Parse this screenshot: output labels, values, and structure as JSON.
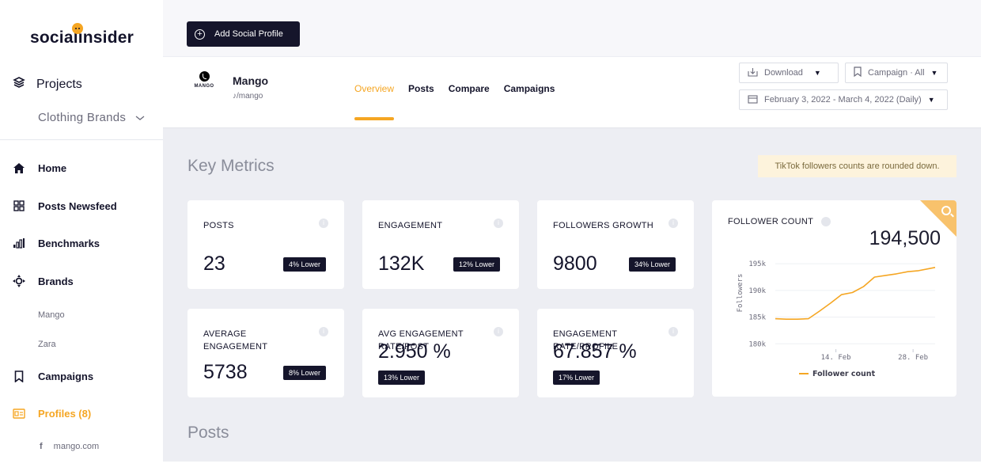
{
  "sidebar": {
    "logo": "socialinsider",
    "projects_label": "Projects",
    "project_selected": "Clothing Brands",
    "nav": {
      "home": "Home",
      "newsfeed": "Posts Newsfeed",
      "benchmarks": "Benchmarks",
      "brands": "Brands",
      "brand_mango": "Mango",
      "brand_zara": "Zara",
      "campaigns": "Campaigns",
      "profiles": "Profiles (8)",
      "profile_site": "mango.com"
    },
    "active_color": "#f5a623"
  },
  "topbar": {
    "add_profile_label": "Add Social Profile"
  },
  "profile": {
    "name": "Mango",
    "logo_text": "MANGO",
    "handle": "/mango",
    "tabs": [
      "Overview",
      "Posts",
      "Compare",
      "Campaigns"
    ],
    "active_tab": "Overview",
    "download_label": "Download",
    "campaign_label": "Campaign · All",
    "date_range": "February 3, 2022 - March 4, 2022 (Daily)"
  },
  "main": {
    "key_metrics_title": "Key Metrics",
    "note": "TikTok followers counts are rounded down.",
    "posts_title": "Posts",
    "metrics": {
      "posts": {
        "label": "POSTS",
        "value": "23",
        "badge": "4% Lower"
      },
      "engagement": {
        "label": "ENGAGEMENT",
        "value": "132K",
        "badge": "12% Lower"
      },
      "followers_growth": {
        "label": "FOLLOWERS GROWTH",
        "value": "9800",
        "badge": "34% Lower"
      },
      "avg_engagement": {
        "label": "AVERAGE ENGAGEMENT",
        "value": "5738",
        "badge": "8% Lower"
      },
      "avg_eng_rate_post": {
        "label": "AVG ENGAGEMENT RATE/POST",
        "value": "2.950 %",
        "badge": "13% Lower"
      },
      "eng_rate_profile": {
        "label": "ENGAGEMENT RATE/PROFILE",
        "value": "67.857 %",
        "badge": "17% Lower"
      }
    },
    "follower_count": {
      "label": "FOLLOWER COUNT",
      "value": "194,500"
    }
  },
  "chart_data": {
    "type": "line",
    "title": "FOLLOWER COUNT",
    "xlabel": "",
    "ylabel": "Followers",
    "ylim": [
      179000,
      196500
    ],
    "yticks": [
      180000,
      185000,
      190000,
      195000
    ],
    "ytick_labels": [
      "180k",
      "185k",
      "190k",
      "195k"
    ],
    "xticks": [
      "14. Feb",
      "28. Feb"
    ],
    "x": [
      "2022-02-03",
      "2022-02-05",
      "2022-02-07",
      "2022-02-09",
      "2022-02-11",
      "2022-02-13",
      "2022-02-15",
      "2022-02-17",
      "2022-02-19",
      "2022-02-21",
      "2022-02-23",
      "2022-02-25",
      "2022-02-27",
      "2022-03-01",
      "2022-03-03",
      "2022-03-04"
    ],
    "series": [
      {
        "name": "Follower count",
        "color": "#f5a623",
        "values": [
          184700,
          184600,
          184600,
          184700,
          186100,
          187600,
          189200,
          189600,
          190700,
          192500,
          192800,
          193100,
          193500,
          193700,
          194100,
          194300
        ]
      }
    ],
    "grid": true,
    "legend": "bottom"
  }
}
